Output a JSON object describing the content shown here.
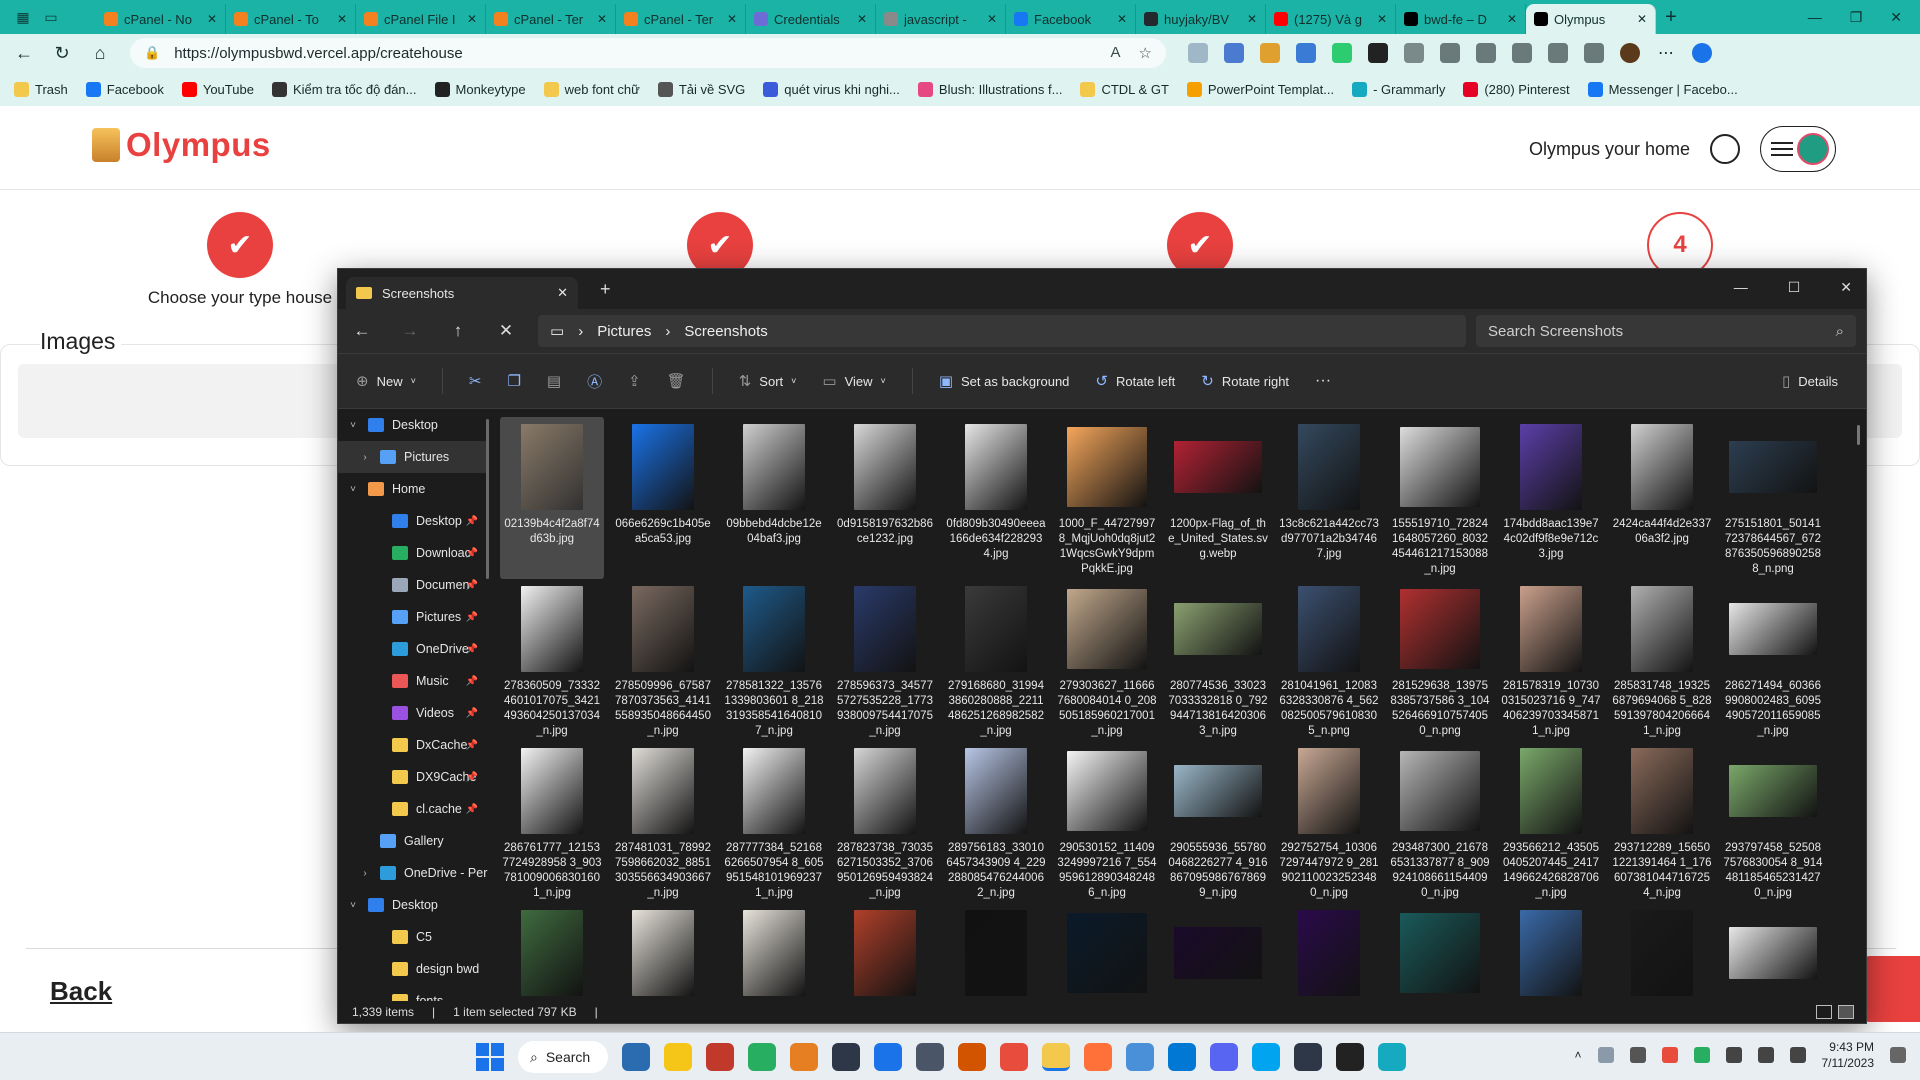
{
  "browser": {
    "tabs": [
      {
        "label": "cPanel - No",
        "color": "#f48120"
      },
      {
        "label": "cPanel - To",
        "color": "#f48120"
      },
      {
        "label": "cPanel File I",
        "color": "#f48120"
      },
      {
        "label": "cPanel - Ter",
        "color": "#f48120"
      },
      {
        "label": "cPanel - Ter",
        "color": "#f48120"
      },
      {
        "label": "Credentials",
        "color": "#6d6bd6"
      },
      {
        "label": "javascript -",
        "color": "#8a8a8a"
      },
      {
        "label": "Facebook",
        "color": "#1877f2"
      },
      {
        "label": "huyjaky/BV",
        "color": "#24292e"
      },
      {
        "label": "(1275) Và g",
        "color": "#ff0000"
      },
      {
        "label": "bwd-fe – D",
        "color": "#000000"
      },
      {
        "label": "Olympus",
        "color": "#000000",
        "active": true
      }
    ],
    "url": "https://olympusbwd.vercel.app/createhouse",
    "bookmarks": [
      {
        "label": "Trash",
        "color": "#f2c94c"
      },
      {
        "label": "Facebook",
        "color": "#1877f2"
      },
      {
        "label": "YouTube",
        "color": "#ff0000"
      },
      {
        "label": "Kiểm tra tốc độ đán...",
        "color": "#333333"
      },
      {
        "label": "Monkeytype",
        "color": "#222222"
      },
      {
        "label": "web font chữ",
        "color": "#f2c94c"
      },
      {
        "label": "Tải về SVG",
        "color": "#555555"
      },
      {
        "label": "quét virus khi nghi...",
        "color": "#3b5bdb"
      },
      {
        "label": "Blush: Illustrations f...",
        "color": "#e64980"
      },
      {
        "label": "CTDL & GT",
        "color": "#f2c94c"
      },
      {
        "label": "PowerPoint Templat...",
        "color": "#f59f00"
      },
      {
        "label": "- Grammarly",
        "color": "#15aabf"
      },
      {
        "label": "(280) Pinterest",
        "color": "#e60023"
      },
      {
        "label": "Messenger | Facebo...",
        "color": "#1877f2"
      }
    ]
  },
  "site": {
    "brand": "Olympus",
    "header_link": "Olympus your home",
    "step1_caption": "Choose your type house",
    "step4_number": "4",
    "images_title": "Images",
    "back_label": "Back",
    "accent": "#e8413f"
  },
  "explorer": {
    "tab_title": "Screenshots",
    "path": [
      "Pictures",
      "Screenshots"
    ],
    "search_placeholder": "Search Screenshots",
    "toolbar": {
      "new": "New",
      "sort": "Sort",
      "view": "View",
      "set_bg": "Set as background",
      "rotate_left": "Rotate left",
      "rotate_right": "Rotate right",
      "more": "···",
      "details": "Details"
    },
    "sidebar": [
      {
        "label": "Desktop",
        "level": 0,
        "chev": "˅",
        "color": "#2f80ed"
      },
      {
        "label": "Pictures",
        "level": 1,
        "chev": "›",
        "color": "#56a0f5",
        "selected": true
      },
      {
        "label": "Home",
        "level": 0,
        "chev": "˅",
        "color": "#f2994a"
      },
      {
        "label": "Desktop",
        "level": 2,
        "chev": "",
        "color": "#2f80ed",
        "pin": true
      },
      {
        "label": "Downloac",
        "level": 2,
        "chev": "",
        "color": "#27ae60",
        "pin": true
      },
      {
        "label": "Documen",
        "level": 2,
        "chev": "",
        "color": "#9aa7b8",
        "pin": true
      },
      {
        "label": "Pictures",
        "level": 2,
        "chev": "",
        "color": "#56a0f5",
        "pin": true
      },
      {
        "label": "OneDrive",
        "level": 2,
        "chev": "",
        "color": "#2d9cdb",
        "pin": true
      },
      {
        "label": "Music",
        "level": 2,
        "chev": "",
        "color": "#eb5757",
        "pin": true
      },
      {
        "label": "Videos",
        "level": 2,
        "chev": "",
        "color": "#9b51e0",
        "pin": true
      },
      {
        "label": "DxCache",
        "level": 2,
        "chev": "",
        "color": "#f2c94c",
        "pin": true
      },
      {
        "label": "DX9Cache",
        "level": 2,
        "chev": "",
        "color": "#f2c94c",
        "pin": true
      },
      {
        "label": "cl.cache",
        "level": 2,
        "chev": "",
        "color": "#f2c94c",
        "pin": true
      },
      {
        "label": "Gallery",
        "level": 1,
        "chev": "",
        "color": "#56a0f5"
      },
      {
        "label": "OneDrive - Per",
        "level": 1,
        "chev": "›",
        "color": "#2d9cdb"
      },
      {
        "label": "Desktop",
        "level": 0,
        "chev": "˅",
        "color": "#2f80ed"
      },
      {
        "label": "C5",
        "level": 2,
        "chev": "",
        "color": "#f2c94c"
      },
      {
        "label": "design bwd",
        "level": 2,
        "chev": "",
        "color": "#f2c94c"
      },
      {
        "label": "fonts",
        "level": 2,
        "chev": "",
        "color": "#f2c94c"
      }
    ],
    "files": [
      {
        "name": "02139b4c4f2a8f74d63b.jpg",
        "c": "#8a7a68",
        "sel": true
      },
      {
        "name": "066e6269c1b405ea5ca53.jpg",
        "c": "#1a73e8"
      },
      {
        "name": "09bbebd4dcbe12e04baf3.jpg",
        "c": "#cfcfcf"
      },
      {
        "name": "0d9158197632b86ce1232.jpg",
        "c": "#d8d8d8"
      },
      {
        "name": "0fd809b30490eeea166de634f2282934.jpg",
        "c": "#e6e6e6"
      },
      {
        "name": "1000_F_447279978_MqjUoh0dq8jut21WqcsGwkY9dpmPqkkE.jpg",
        "c": "#f5a65b"
      },
      {
        "name": "1200px-Flag_of_the_United_States.svg.webp",
        "c": "#b22234"
      },
      {
        "name": "13c8c621a442cc73d977071a2b347467.jpg",
        "c": "#34495e"
      },
      {
        "name": "155519710_728241648057260_8032454461217153088_n.jpg",
        "c": "#dcdcdc"
      },
      {
        "name": "174bdd8aac139e74c02df9f8e9e712c3.jpg",
        "c": "#5b3fa8"
      },
      {
        "name": "2424ca44f4d2e33706a3f2.jpg",
        "c": "#d0d0d0"
      },
      {
        "name": "275151801_5014172378644567_672876350596890258 8_n.png",
        "c": "#2c3e50"
      },
      {
        "name": "278360509_733324601017075_3421493604250137034_n.jpg",
        "c": "#f0f0f0"
      },
      {
        "name": "278509996_675877870373563_4141558935048664450_n.jpg",
        "c": "#7a6a60"
      },
      {
        "name": "278581322_135761339803601 8_218319358541640810 7_n.jpg",
        "c": "#1e5a8a"
      },
      {
        "name": "278596373_345775727535228_1773938009754417075_n.jpg",
        "c": "#2a3a6a"
      },
      {
        "name": "279168680_319943860280888_2211486251268982582_n.jpg",
        "c": "#3a3a3a"
      },
      {
        "name": "279303627_116667680084014 0_208505185960217001_n.jpg",
        "c": "#c2a88c"
      },
      {
        "name": "280774536_330237033332818 0_792944713816420306 3_n.jpg",
        "c": "#8aa070"
      },
      {
        "name": "281041961_120836328330876 4_562082500579610830 5_n.png",
        "c": "#3b5070"
      },
      {
        "name": "281529638_139758385737586 3_104526466910757405 0_n.png",
        "c": "#b03030"
      },
      {
        "name": "281578319_107300315023716 9_747406239703345871 1_n.jpg",
        "c": "#caa08c"
      },
      {
        "name": "285831748_193256879694068 5_828591397804206664 1_n.jpg",
        "c": "#b0b0b0"
      },
      {
        "name": "286271494_603669908002483_6095490572011659085_n.jpg",
        "c": "#e6e6e6"
      },
      {
        "name": "286761777_121537724928958 3_903781009006830160 1_n.jpg",
        "c": "#f2f2f2"
      },
      {
        "name": "287481031_789927598662032_8851303556634903667_n.jpg",
        "c": "#e0ddd8"
      },
      {
        "name": "287777384_521686266507954 8_605951548101969237 1_n.jpg",
        "c": "#f2f2f2"
      },
      {
        "name": "287823738_730356271503352_3706950126959493824_n.jpg",
        "c": "#d6d6d6"
      },
      {
        "name": "289756183_330106457343909 4_229288085476244006 2_n.jpg",
        "c": "#b8c6e6"
      },
      {
        "name": "290530152_114093249997216 7_554959612890348248 6_n.jpg",
        "c": "#f4f4f4"
      },
      {
        "name": "290555936_557800468226277 4_916867095986767869 9_n.jpg",
        "c": "#9ab6c8"
      },
      {
        "name": "292752754_103067297447972 9_281902110023252348 0_n.jpg",
        "c": "#c8a894"
      },
      {
        "name": "293487300_216786531337877 8_909924108661154409 0_n.jpg",
        "c": "#b6b6b6"
      },
      {
        "name": "293566212_435050405207445_2417149662426828706_n.jpg",
        "c": "#7aa86a"
      },
      {
        "name": "293712289_156501221391464 1_176607381044716725 4_n.jpg",
        "c": "#8a6a5a"
      },
      {
        "name": "293797458_525087576830054 8_914481185465231427 0_n.jpg",
        "c": "#7aa86a"
      },
      {
        "name": "",
        "c": "#3f6b3f"
      },
      {
        "name": "",
        "c": "#e8e4dc"
      },
      {
        "name": "",
        "c": "#e8e4dc"
      },
      {
        "name": "",
        "c": "#b0402a"
      },
      {
        "name": "",
        "c": "#111111"
      },
      {
        "name": "",
        "c": "#0a1a2a"
      },
      {
        "name": "",
        "c": "#1a0a2a"
      },
      {
        "name": "",
        "c": "#2a0a4a"
      },
      {
        "name": "",
        "c": "#1a5a5a"
      },
      {
        "name": "",
        "c": "#3a6aa8"
      },
      {
        "name": "",
        "c": "#1a1a1a"
      },
      {
        "name": "",
        "c": "#e8e8e8"
      }
    ],
    "status_count": "1,339 items",
    "status_selected": "1 item selected  797 KB"
  },
  "taskbar": {
    "search": "Search",
    "apps": [
      "#2b6cb0",
      "#f5c518",
      "#c0392b",
      "#27ae60",
      "#e67e22",
      "#2d3748",
      "#1a73e8",
      "#4a5568",
      "#d35400",
      "#e74c3c",
      "#f2c94c",
      "#ff7139",
      "#4a90d9",
      "#0078d4",
      "#5865f2",
      "#00a4ef",
      "#2d3748",
      "#222222",
      "#15aabf"
    ],
    "time": "9:43 PM",
    "date": "7/11/2023"
  }
}
